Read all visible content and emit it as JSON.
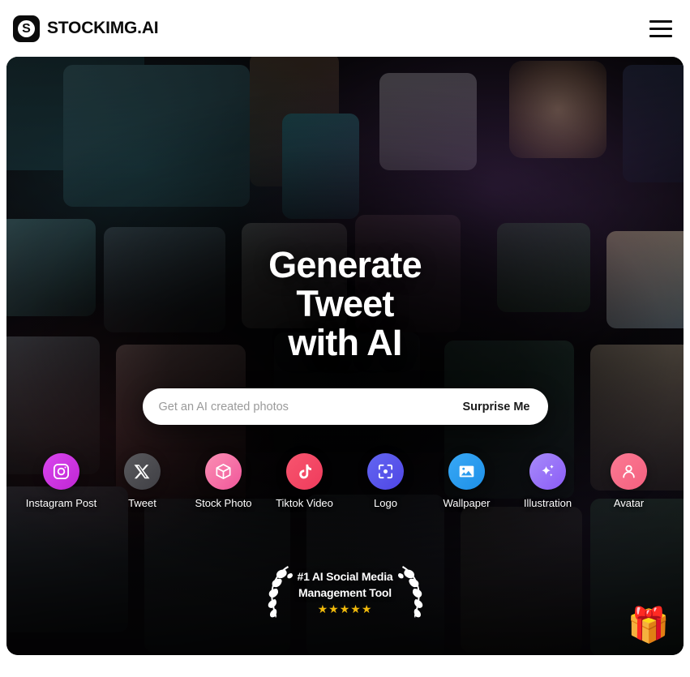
{
  "header": {
    "brand_mark_letter": "S",
    "brand_name": "STOCKIMG.AI",
    "menu_icon": "hamburger-icon"
  },
  "hero": {
    "title_lines": [
      "Generate",
      "Tweet",
      "with AI"
    ],
    "search": {
      "placeholder": "Get an AI created photos",
      "value": "",
      "action_label": "Surprise Me"
    },
    "categories": [
      {
        "label": "Instagram Post",
        "icon": "instagram-icon",
        "color_start": "#d946ef",
        "color_end": "#c026d3"
      },
      {
        "label": "Tweet",
        "icon": "x-twitter-icon",
        "color_start": "#5a5a5e",
        "color_end": "#3f3f44"
      },
      {
        "label": "Stock Photo",
        "icon": "box-icon",
        "color_start": "#fb8fb4",
        "color_end": "#f0569a"
      },
      {
        "label": "Tiktok Video",
        "icon": "tiktok-icon",
        "color_start": "#f7556f",
        "color_end": "#ef3b5c"
      },
      {
        "label": "Logo",
        "icon": "focus-target-icon",
        "color_start": "#6366f1",
        "color_end": "#4f46e5"
      },
      {
        "label": "Wallpaper",
        "icon": "image-icon",
        "color_start": "#38a8f5",
        "color_end": "#1e90e8"
      },
      {
        "label": "Illustration",
        "icon": "sparkle-icon",
        "color_start": "#a78bfa",
        "color_end": "#8b5cf6"
      },
      {
        "label": "Avatar",
        "icon": "person-icon",
        "color_start": "#fb7a93",
        "color_end": "#f4607f"
      }
    ],
    "award": {
      "line1": "#1 AI Social Media",
      "line2": "Management Tool",
      "stars": "★★★★★",
      "star_color": "#f0b90b",
      "left_icon": "laurel-wreath-left-icon",
      "right_icon": "laurel-wreath-right-icon"
    },
    "gift_widget": {
      "icon": "gift-box-icon",
      "glyph": "🎁"
    }
  }
}
